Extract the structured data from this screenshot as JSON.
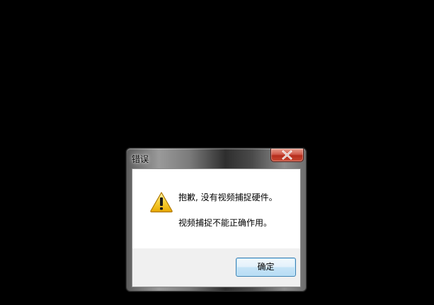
{
  "dialog": {
    "title": "错误",
    "icon": "warning-icon",
    "message_line_1": "抱歉, 没有视频捕捉硬件。",
    "message_line_2": "视频捕捉不能正确作用。",
    "ok_button_label": "确定",
    "close_icon": "close-icon"
  },
  "colors": {
    "desktop_background": "#000000",
    "close_button_red": "#c84a34",
    "warning_yellow": "#f5c400",
    "button_border_blue": "#3c7fb1"
  }
}
